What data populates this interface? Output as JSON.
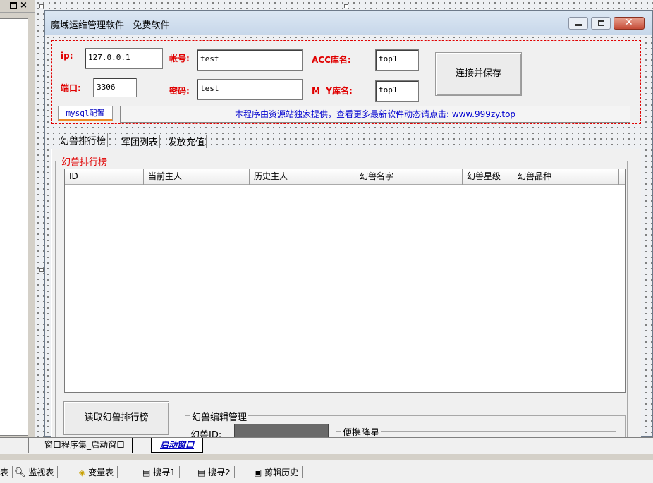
{
  "window": {
    "title": "魔域运维管理软件   免费软件"
  },
  "connection": {
    "ip_label": "ip:",
    "ip_value": "127.0.0.1",
    "port_label": "端口:",
    "port_value": "3306",
    "account_label": "帐号:",
    "account_value": "test",
    "password_label": "密码:",
    "password_value": "test",
    "acc_db_label": "ACC库名:",
    "acc_db_value": "top1",
    "my_db_label": "M  Y库名:",
    "my_db_value": "top1",
    "connect_button": "连接并保存"
  },
  "mysql_tab": "mysql配置",
  "banner": "本程序由资源站独家提供，查看更多最新软件动态请点击: www.999zy.top",
  "tabs": [
    "幻兽排行榜",
    "军团列表",
    "发放充值"
  ],
  "ranking": {
    "group_title": "幻兽排行榜",
    "columns": [
      "ID",
      "当前主人",
      "历史主人",
      "幻兽名字",
      "幻兽星级",
      "幻兽品种"
    ],
    "read_button": "读取幻兽排行榜",
    "edit_group_title": "幻兽编辑管理",
    "pet_id_label": "幻兽ID:",
    "star_group_title": "便携降星"
  },
  "doc_tabs": [
    "窗口程序集_启动窗口",
    "启动窗口"
  ],
  "bottom_bar": [
    "表",
    "监视表",
    "变量表",
    "搜寻1",
    "搜寻2",
    "剪辑历史"
  ],
  "colors": {
    "accent_red": "#e00000",
    "banner_text": "#0000d0",
    "close_red": "#c75050"
  }
}
